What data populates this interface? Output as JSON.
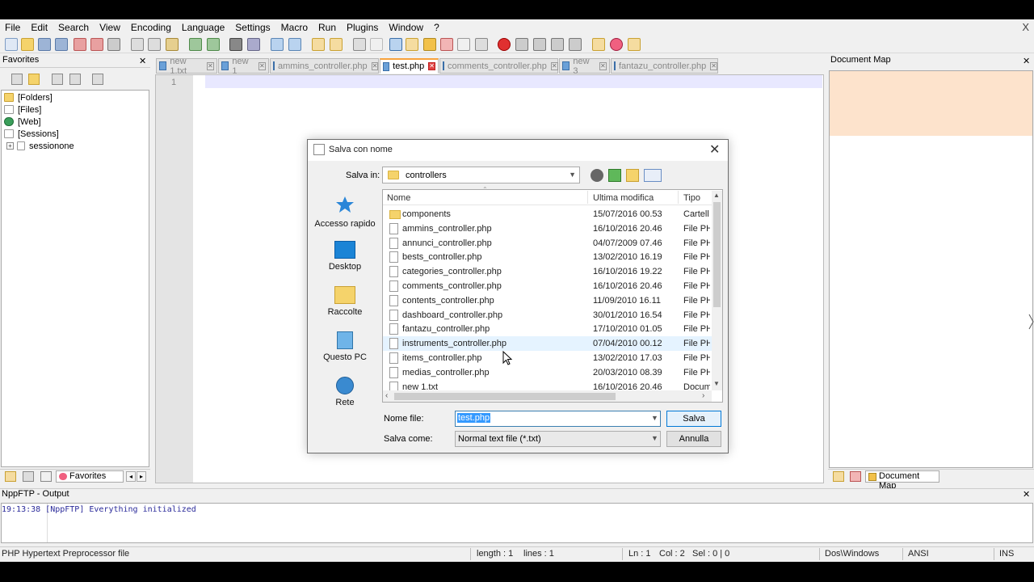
{
  "window": {
    "close_symbol": "X"
  },
  "menu": [
    "File",
    "Edit",
    "Search",
    "View",
    "Encoding",
    "Language",
    "Settings",
    "Macro",
    "Run",
    "Plugins",
    "Window",
    "?"
  ],
  "favorites_panel": {
    "title": "Favorites",
    "close_symbol": "✕",
    "tree": [
      "[Folders]",
      "[Files]",
      "[Web]",
      "[Sessions]",
      "sessionone"
    ],
    "bottom_tab_label": "Favorites"
  },
  "tabs": [
    {
      "label": "new 1.txt",
      "active": false
    },
    {
      "label": "new 1",
      "active": false
    },
    {
      "label": "ammins_controller.php",
      "active": false
    },
    {
      "label": "test.php",
      "active": true
    },
    {
      "label": "comments_controller.php",
      "active": false
    },
    {
      "label": "new 3",
      "active": false
    },
    {
      "label": "fantazu_controller.php",
      "active": false
    }
  ],
  "editor": {
    "line_number": "1"
  },
  "document_map": {
    "title": "Document Map",
    "close_symbol": "✕",
    "bottom_tab_label": "Document Map"
  },
  "output": {
    "title": "NppFTP - Output",
    "close_symbol": "✕",
    "line": "19:13:38  [NppFTP] Everything initialized"
  },
  "status": {
    "file_type": "PHP Hypertext Preprocessor file",
    "length": "length : 1",
    "lines": "lines : 1",
    "ln": "Ln : 1",
    "col": "Col : 2",
    "sel": "Sel : 0 | 0",
    "eol": "Dos\\Windows",
    "encoding": "ANSI",
    "mode": "INS"
  },
  "dialog": {
    "title": "Salva con nome",
    "close_symbol": "✕",
    "save_in_label": "Salva in:",
    "save_in_value": "controllers",
    "places": [
      "Accesso rapido",
      "Desktop",
      "Raccolte",
      "Questo PC",
      "Rete"
    ],
    "columns": [
      "Nome",
      "Ultima modifica",
      "Tipo"
    ],
    "files": [
      {
        "name": "components",
        "date": "15/07/2016 00.53",
        "type": "Cartell",
        "folder": true
      },
      {
        "name": "ammins_controller.php",
        "date": "16/10/2016 20.46",
        "type": "File PH",
        "folder": false
      },
      {
        "name": "annunci_controller.php",
        "date": "04/07/2009 07.46",
        "type": "File PH",
        "folder": false
      },
      {
        "name": "bests_controller.php",
        "date": "13/02/2010 16.19",
        "type": "File PH",
        "folder": false
      },
      {
        "name": "categories_controller.php",
        "date": "16/10/2016 19.22",
        "type": "File PH",
        "folder": false
      },
      {
        "name": "comments_controller.php",
        "date": "16/10/2016 20.46",
        "type": "File PH",
        "folder": false
      },
      {
        "name": "contents_controller.php",
        "date": "11/09/2010 16.11",
        "type": "File PH",
        "folder": false
      },
      {
        "name": "dashboard_controller.php",
        "date": "30/01/2010 16.54",
        "type": "File PH",
        "folder": false
      },
      {
        "name": "fantazu_controller.php",
        "date": "17/10/2010 01.05",
        "type": "File PH",
        "folder": false
      },
      {
        "name": "instruments_controller.php",
        "date": "07/04/2010 00.12",
        "type": "File PH",
        "folder": false
      },
      {
        "name": "items_controller.php",
        "date": "13/02/2010 17.03",
        "type": "File PH",
        "folder": false
      },
      {
        "name": "medias_controller.php",
        "date": "20/03/2010 08.39",
        "type": "File PH",
        "folder": false
      },
      {
        "name": "new 1.txt",
        "date": "16/10/2016 20.46",
        "type": "Docum",
        "folder": false
      }
    ],
    "filename_label": "Nome file:",
    "filename_value": "test.php",
    "savetype_label": "Salva come:",
    "savetype_value": "Normal text file (*.txt)",
    "save_button": "Salva",
    "cancel_button": "Annulla"
  }
}
